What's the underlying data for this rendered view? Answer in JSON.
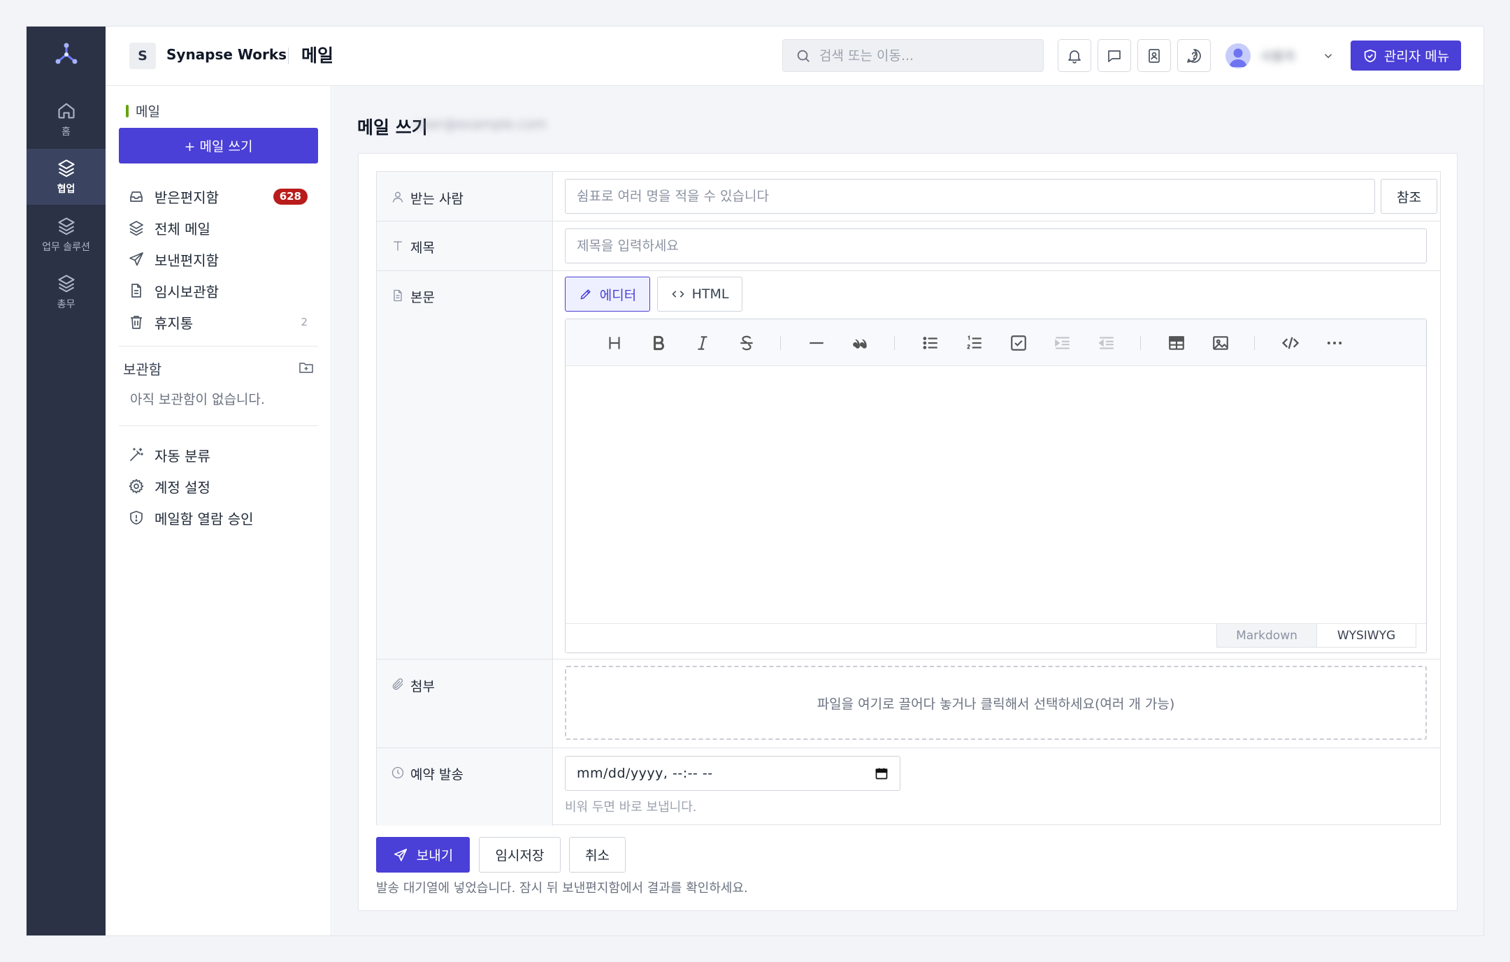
{
  "colors": {
    "accent": "#4a3fd6",
    "rail": "#2b3245",
    "badge": "#b91c1c",
    "section_bar": "#65a30d"
  },
  "rail": {
    "items": [
      {
        "label": "홈",
        "icon": "home-icon"
      },
      {
        "label": "협업",
        "icon": "layers-icon",
        "active": true
      },
      {
        "label": "업무 솔루션",
        "icon": "layers-icon"
      },
      {
        "label": "총무",
        "icon": "layers-icon"
      }
    ]
  },
  "header": {
    "workspace_initial": "S",
    "workspace_name": "Synapse Works",
    "title": "메일",
    "search_placeholder": "검색 또는 이동...",
    "user_name": "사용자",
    "admin_label": "관리자 메뉴"
  },
  "sidebar": {
    "section_title": "메일",
    "compose_label": "+ 메일 쓰기",
    "items": [
      {
        "label": "받은편지함",
        "badge": "628"
      },
      {
        "label": "전체 메일"
      },
      {
        "label": "보낸편지함"
      },
      {
        "label": "임시보관함"
      },
      {
        "label": "휴지통",
        "count": "2"
      }
    ],
    "archive_title": "보관함",
    "archive_empty": "아직 보관함이 없습니다.",
    "settings": [
      {
        "label": "자동 분류"
      },
      {
        "label": "계정 설정"
      },
      {
        "label": "메일함 열람 승인"
      }
    ]
  },
  "compose": {
    "title": "메일 쓰기",
    "from_address": "user@example.com",
    "labels": {
      "to": "받는 사람",
      "subject": "제목",
      "body": "본문",
      "attachment": "첨부",
      "schedule": "예약 발송"
    },
    "to_placeholder": "쉼표로 여러 명을 적을 수 있습니다",
    "ref_label": "참조",
    "subject_placeholder": "제목을 입력하세요",
    "mode_editor": "에디터",
    "mode_html": "HTML",
    "tab_markdown": "Markdown",
    "tab_wysiwyg": "WYSIWYG",
    "dropzone_text": "파일을 여기로 끌어다 놓거나 클릭해서 선택하세요(여러 개 가능)",
    "datetime_value": "mm/dd/yyyy, --:-- --",
    "schedule_hint": "비워 두면 바로 보냅니다.",
    "send_label": "보내기",
    "draft_label": "임시저장",
    "cancel_label": "취소",
    "status_message": "발송 대기열에 넣었습니다. 잠시 뒤 보낸편지함에서 결과를 확인하세요."
  }
}
